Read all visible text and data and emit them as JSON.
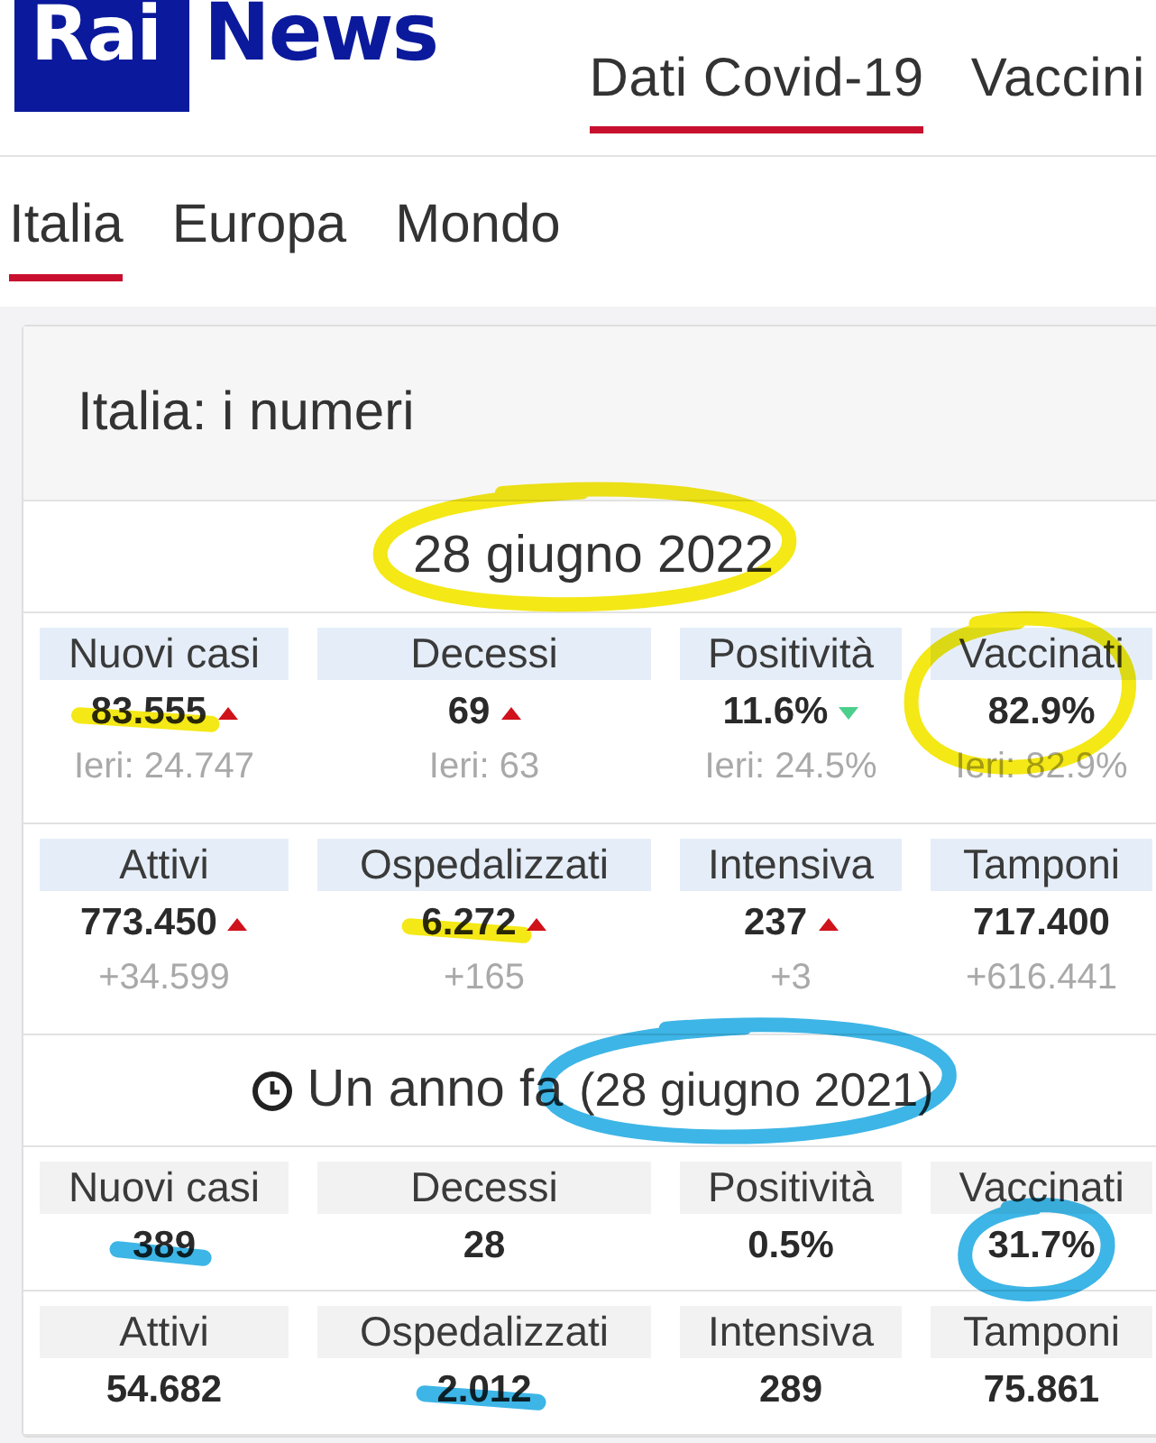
{
  "header": {
    "logo": {
      "mark": "Rai",
      "word": "News"
    },
    "nav": [
      {
        "label": "Dati Covid-19",
        "selected": true
      },
      {
        "label": "Vaccini",
        "selected": false
      }
    ]
  },
  "tabs": [
    {
      "label": "Italia",
      "selected": true
    },
    {
      "label": "Europa",
      "selected": false
    },
    {
      "label": "Mondo",
      "selected": false
    }
  ],
  "card": {
    "title": "Italia: i numeri",
    "sections": [
      {
        "kind": "current",
        "heading": "28 giugno 2022",
        "heading_mark": {
          "kind": "ellipse",
          "color": "#f4e816"
        },
        "rows": [
          [
            {
              "label": "Nuovi casi",
              "value": "83.555",
              "rising": true,
              "sub": "Ieri: 24.747",
              "mark": {
                "kind": "underline",
                "color": "#f4e816"
              }
            },
            {
              "label": "Decessi",
              "value": "69",
              "rising": true,
              "sub": "Ieri: 63"
            },
            {
              "label": "Positività",
              "value": "11.6%",
              "rising": false,
              "sub": "Ieri: 24.5%"
            },
            {
              "label": "Vaccinati",
              "value": "82.9%",
              "sub": "Ieri: 82.9%",
              "mark": {
                "kind": "cell_ring",
                "color": "#f4e816"
              }
            }
          ],
          [
            {
              "label": "Attivi",
              "value": "773.450",
              "rising": true,
              "sub": "+34.599"
            },
            {
              "label": "Ospedalizzati",
              "value": "6.272",
              "rising": true,
              "sub": "+165",
              "mark": {
                "kind": "underline",
                "color": "#f4e816"
              }
            },
            {
              "label": "Intensiva",
              "value": "237",
              "rising": true,
              "sub": "+3"
            },
            {
              "label": "Tamponi",
              "value": "717.400",
              "sub": "+616.441"
            }
          ]
        ]
      },
      {
        "kind": "past",
        "heading": "Un anno fa",
        "note": "(28 giugno 2021)",
        "note_mark": {
          "kind": "ellipse",
          "color": "#3db5e6"
        },
        "rows": [
          [
            {
              "label": "Nuovi casi",
              "value": "389",
              "mark": {
                "kind": "underline",
                "color": "#3db5e6"
              }
            },
            {
              "label": "Decessi",
              "value": "28"
            },
            {
              "label": "Positività",
              "value": "0.5%"
            },
            {
              "label": "Vaccinati",
              "value": "31.7%",
              "mark": {
                "kind": "value_ring",
                "color": "#3db5e6"
              }
            }
          ],
          [
            {
              "label": "Attivi",
              "value": "54.682"
            },
            {
              "label": "Ospedalizzati",
              "value": "2.012",
              "mark": {
                "kind": "underline",
                "color": "#3db5e6"
              }
            },
            {
              "label": "Intensiva",
              "value": "289"
            },
            {
              "label": "Tamponi",
              "value": "75.861"
            }
          ]
        ]
      }
    ]
  }
}
